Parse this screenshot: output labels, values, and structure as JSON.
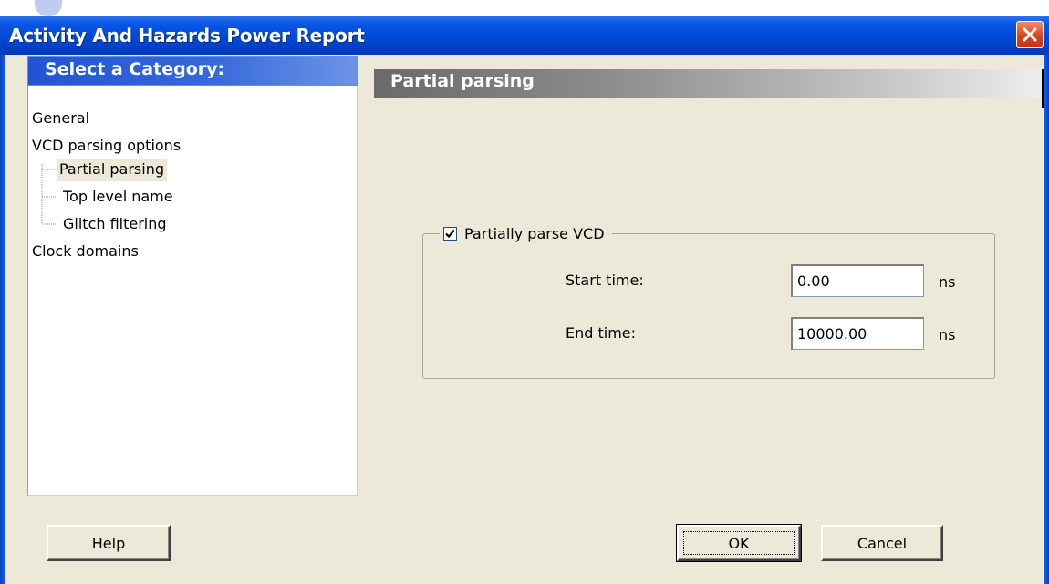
{
  "window": {
    "title": "Activity And Hazards Power Report",
    "close_icon": "close-icon"
  },
  "categories": {
    "header": "Select a Category:",
    "items": [
      {
        "label": "General"
      },
      {
        "label": "VCD parsing options"
      },
      {
        "label": "Partial parsing",
        "selected": true
      },
      {
        "label": "Top level name"
      },
      {
        "label": "Glitch filtering"
      },
      {
        "label": "Clock domains"
      }
    ]
  },
  "panel": {
    "header": "Partial parsing",
    "group": {
      "checkbox_label": "Partially parse VCD",
      "checked": true,
      "start_time_label": "Start time:",
      "start_time_value": "0.00",
      "start_time_unit": "ns",
      "end_time_label": "End time:",
      "end_time_value": "10000.00",
      "end_time_unit": "ns"
    }
  },
  "buttons": {
    "help": "Help",
    "ok": "OK",
    "cancel": "Cancel"
  },
  "colors": {
    "titlebar": "#0049d8",
    "close": "#d8461d",
    "category_header": "#2154d4",
    "dialog_bg": "#ece9d8"
  }
}
